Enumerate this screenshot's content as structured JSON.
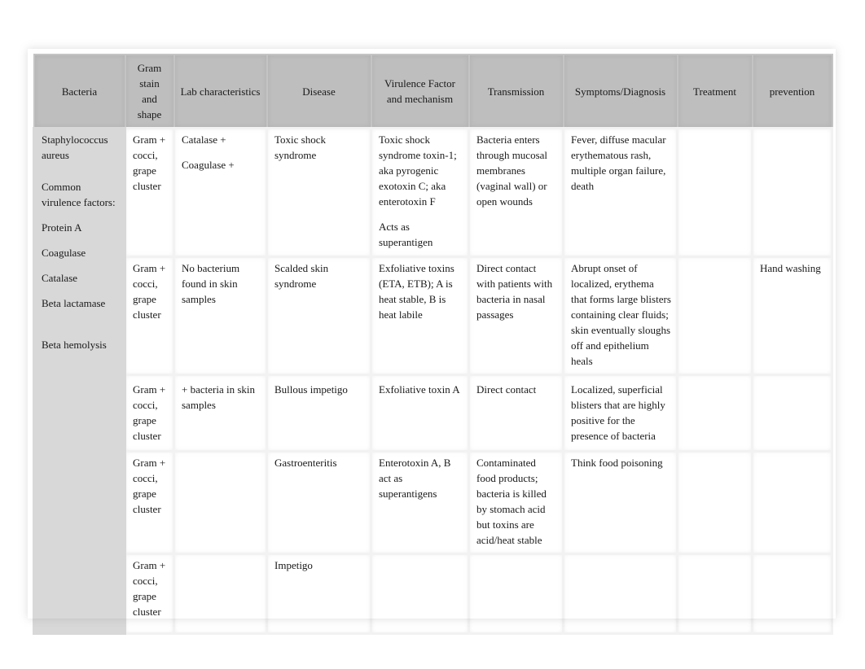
{
  "table": {
    "headers": [
      "Bacteria",
      "Gram stain and shape",
      "Lab characteristics",
      "Disease",
      "Virulence Factor and mechanism",
      "Transmission",
      "Symptoms/Diagnosis",
      "Treatment",
      "prevention"
    ],
    "bacteria": {
      "name": "Staphylococcus aureus",
      "common_label": "Common virulence factors:",
      "factors": [
        "Protein A",
        "Coagulase",
        "Catalase",
        "Beta lactamase",
        "Beta hemolysis"
      ]
    },
    "rows": [
      {
        "gram": "Gram + cocci, grape cluster",
        "lab": [
          "Catalase +",
          "Coagulase +"
        ],
        "disease": "Toxic shock syndrome",
        "virulence": [
          "Toxic shock syndrome toxin-1; aka pyrogenic exotoxin C; aka enterotoxin F",
          "Acts as superantigen"
        ],
        "transmission": "Bacteria enters through mucosal membranes (vaginal wall) or open wounds",
        "symptoms": "Fever, diffuse macular erythematous rash, multiple organ failure, death",
        "treatment": "",
        "prevention": ""
      },
      {
        "gram": "Gram + cocci, grape cluster",
        "lab": [
          "No bacterium found in skin samples"
        ],
        "disease": "Scalded skin syndrome",
        "virulence": [
          "Exfoliative toxins (ETA, ETB); A is heat stable, B is heat labile"
        ],
        "transmission": "Direct contact with patients with bacteria in nasal passages",
        "symptoms": "Abrupt onset of localized, erythema that forms large blisters containing clear fluids; skin eventually sloughs off and epithelium heals",
        "treatment": "",
        "prevention": "Hand washing"
      },
      {
        "gram": "Gram + cocci, grape cluster",
        "lab": [
          "+ bacteria in skin samples"
        ],
        "disease": "Bullous impetigo",
        "virulence": [
          "Exfoliative toxin A"
        ],
        "transmission": "Direct contact",
        "symptoms": "Localized, superficial blisters that are highly positive for the presence of bacteria",
        "treatment": "",
        "prevention": ""
      },
      {
        "gram": "Gram + cocci, grape cluster",
        "lab": [
          ""
        ],
        "disease": "Gastroenteritis",
        "virulence": [
          "Enterotoxin A, B act as superantigens"
        ],
        "transmission": "Contaminated food products; bacteria is killed by stomach acid but toxins are acid/heat stable",
        "symptoms": "Think food poisoning",
        "treatment": "",
        "prevention": ""
      },
      {
        "gram": "Gram + cocci, grape cluster",
        "lab": [
          ""
        ],
        "disease": "Impetigo",
        "virulence": [
          ""
        ],
        "transmission": "",
        "symptoms": "",
        "treatment": "",
        "prevention": ""
      }
    ]
  }
}
